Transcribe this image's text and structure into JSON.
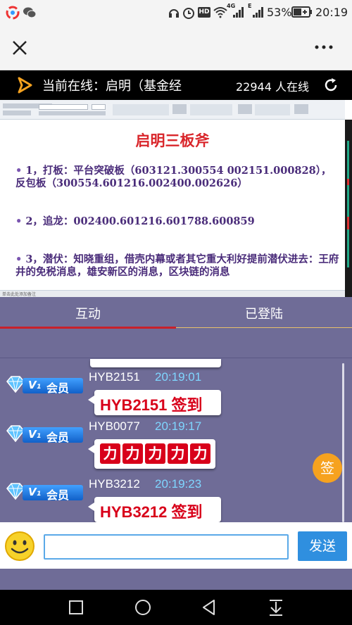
{
  "status_bar": {
    "network_4g": "4G",
    "network_e": "E",
    "hd": "HD",
    "battery": "53%",
    "time": "20:19"
  },
  "live": {
    "label": "当前在线：启明（基金经",
    "online_count": "22944 人在线"
  },
  "slide": {
    "title": "启明三板斧",
    "items": [
      {
        "num": "1，",
        "text": "打板：平台突破板（603121.300554 002151.000828），反包板（300554.601216.002400.002626）"
      },
      {
        "num": "2，",
        "text": "追龙：002400.601216.601788.600859"
      },
      {
        "num": "3，",
        "text": "潜伏：知晓重组，借壳内幕或者其它重大利好提前潜伏进去：王府井的免税消息，雄安新区的消息，区块链的消息"
      }
    ],
    "statusbar_text": "单击此处添加备注"
  },
  "tabs": [
    {
      "label": "互动"
    },
    {
      "label": "已登陆"
    }
  ],
  "badge": {
    "v": "V₁",
    "label": "会员"
  },
  "messages": [
    {
      "user": "HYB2151",
      "time": "20:19:01",
      "text": "HYB2151 签到"
    },
    {
      "user": "HYB0077",
      "time": "20:19:17",
      "boxes": [
        "力",
        "力",
        "力",
        "力",
        "力"
      ]
    },
    {
      "user": "HYB3212",
      "time": "20:19:23",
      "text": "HYB3212 签到"
    }
  ],
  "sign_button": "签",
  "input": {
    "value": "",
    "placeholder": ""
  },
  "send_button": "发送",
  "colors": {
    "accent_red": "#d8001a",
    "tab_indicator": "#c8202a",
    "chat_bg": "#6f6c97",
    "send_bg": "#2f8fdf",
    "sign_bg": "#f6a21f"
  },
  "icons": {
    "close": "close-icon",
    "more": "more-icon",
    "refresh": "refresh-icon",
    "emoji": "smiley-icon"
  }
}
